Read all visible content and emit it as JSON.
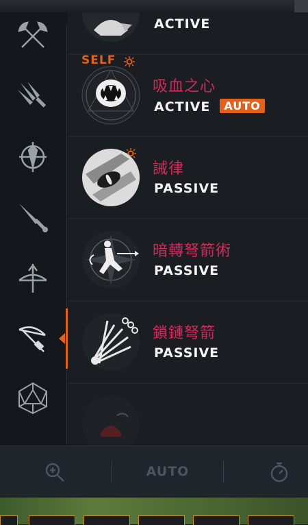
{
  "skills": [
    {
      "name": "",
      "type": "ACTIVE",
      "icon": "beast-skull-icon"
    },
    {
      "name": "吸血之心",
      "type": "ACTIVE",
      "self_tag": "SELF",
      "auto_badge": "AUTO",
      "icon": "fanged-maw-icon"
    },
    {
      "name": "誡律",
      "type": "PASSIVE",
      "icon": "dragon-eye-icon"
    },
    {
      "name": "暗轉弩箭術",
      "type": "PASSIVE",
      "icon": "dodging-figure-icon"
    },
    {
      "name": "鎖鏈弩箭",
      "type": "PASSIVE",
      "icon": "chain-bolt-icon"
    },
    {
      "name": "",
      "type": "",
      "icon": "helmet-icon"
    }
  ],
  "sidebar_categories": [
    "crossed-axes-icon",
    "triple-blade-icon",
    "shield-sword-icon",
    "dagger-icon",
    "bow-icon",
    "crossbow-icon",
    "d20-icon"
  ],
  "bottom_bar": {
    "auto_label": "AUTO",
    "zoom_icon": "zoom-in-icon",
    "timer_icon": "stopwatch-icon"
  },
  "colors": {
    "accent": "#e0621c",
    "skill_name": "#d5295a",
    "panel": "#1a1d22"
  }
}
